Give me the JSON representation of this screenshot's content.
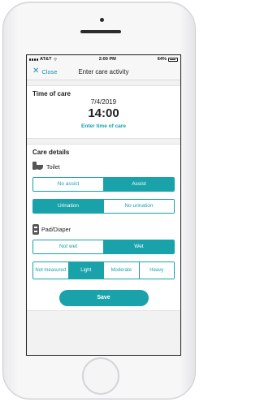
{
  "status_bar": {
    "carrier": "AT&T",
    "time": "2:00 PM",
    "battery": "64%"
  },
  "nav": {
    "close_label": "Close",
    "title": "Enter care activity"
  },
  "time_of_care": {
    "heading": "Time of care",
    "date": "7/4/2019",
    "time": "14:00",
    "link": "Enter time of care"
  },
  "care_details": {
    "heading": "Care details",
    "toilet": {
      "label": "Toilet",
      "assist_options": [
        "No assist",
        "Assist"
      ],
      "assist_selected": "Assist",
      "urination_options": [
        "Urination",
        "No urination"
      ],
      "urination_selected": "Urination"
    },
    "diaper": {
      "label": "Pad/Diaper",
      "wet_options": [
        "Not wet",
        "Wet"
      ],
      "wet_selected": "Wet",
      "level_options": [
        "Not measured",
        "Light",
        "Moderate",
        "Heavy"
      ],
      "level_selected": "Light"
    }
  },
  "save_label": "Save",
  "colors": {
    "accent": "#1aa2aa",
    "link": "#1d8fb0"
  },
  "icons": [
    "close-icon",
    "toilet-icon",
    "diaper-icon",
    "signal-icon",
    "wifi-icon",
    "battery-icon"
  ]
}
